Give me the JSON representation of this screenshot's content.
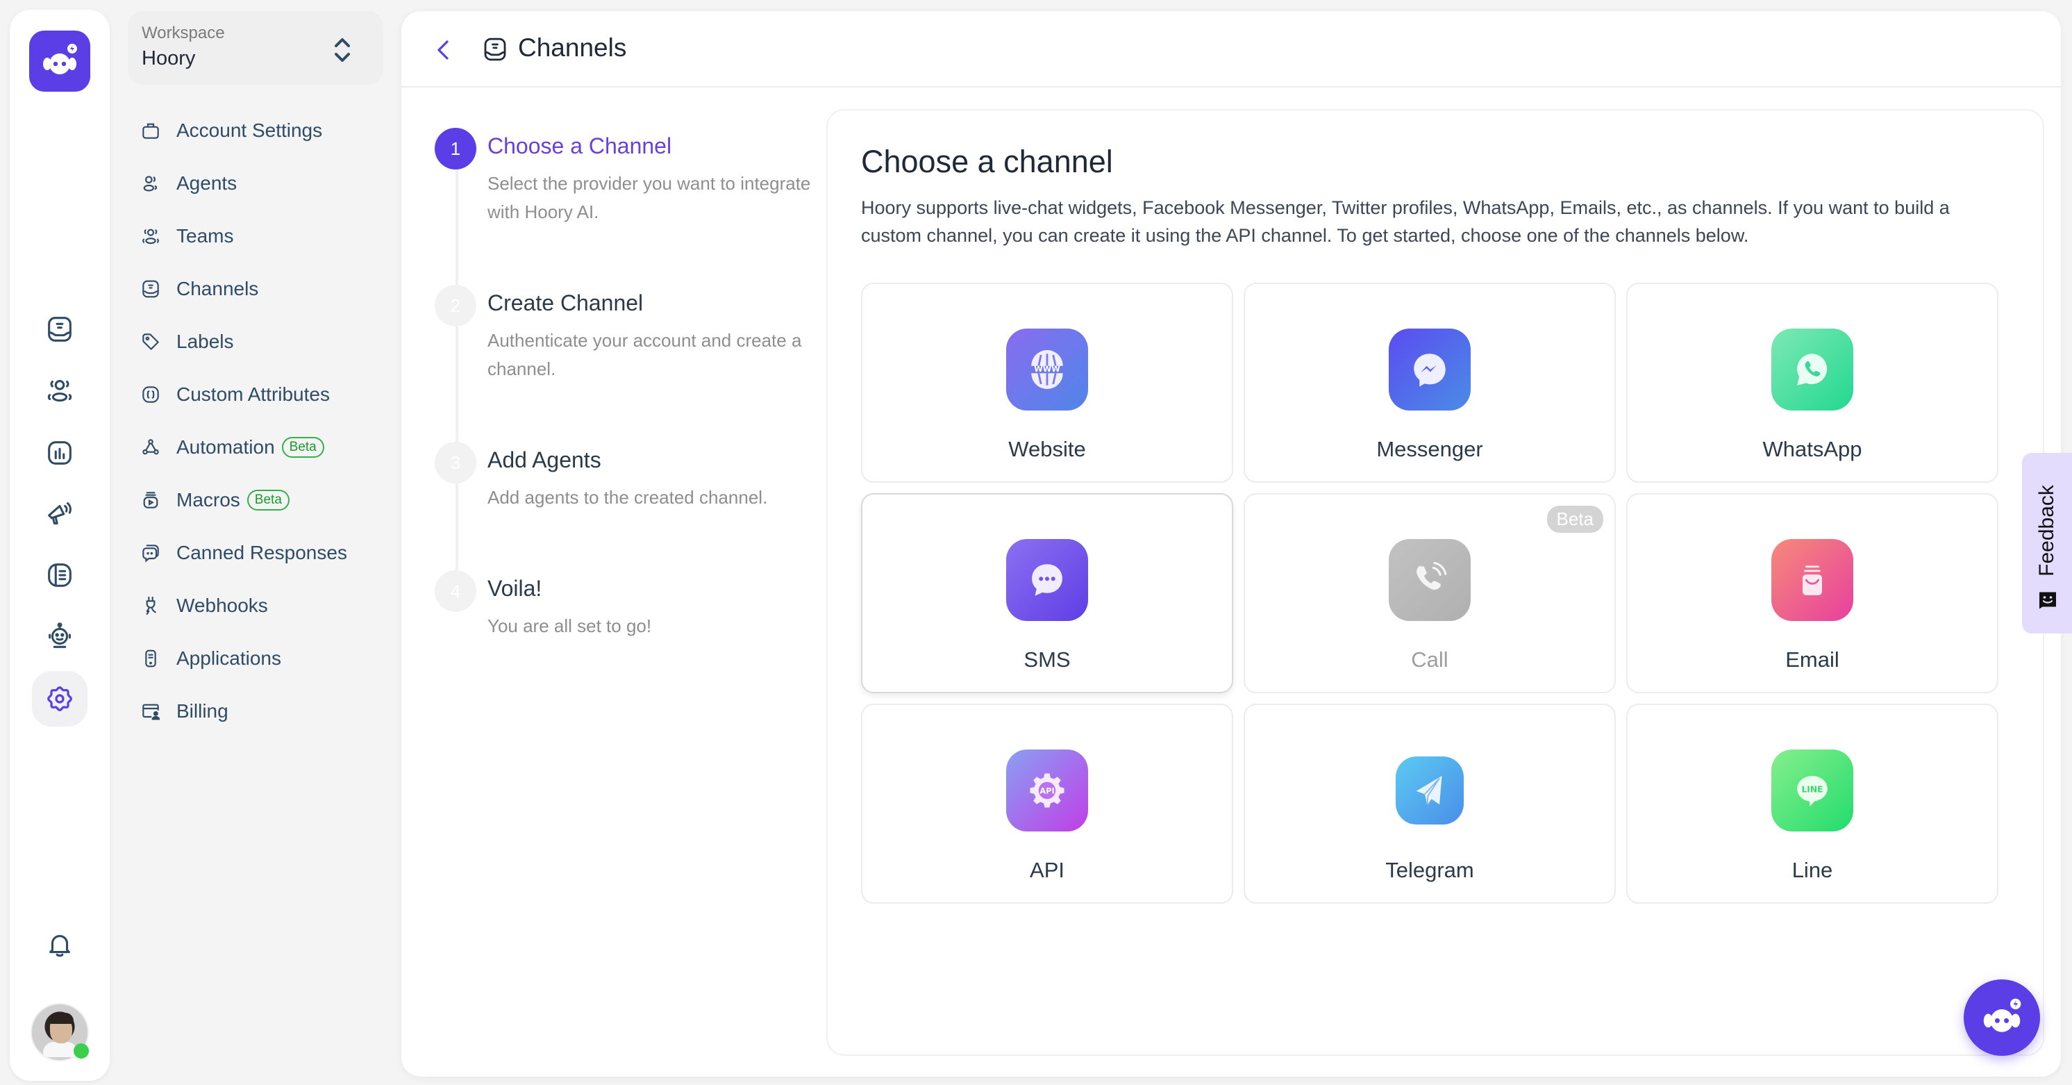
{
  "app": {
    "brand_color": "#5b3ee6",
    "logo": "hoory-bot-logo"
  },
  "rail": {
    "items": [
      {
        "name": "conversations",
        "icon": "inbox-icon"
      },
      {
        "name": "contacts",
        "icon": "contacts-icon"
      },
      {
        "name": "reports",
        "icon": "reports-icon"
      },
      {
        "name": "campaigns",
        "icon": "megaphone-icon"
      },
      {
        "name": "help-center",
        "icon": "book-icon"
      },
      {
        "name": "bot",
        "icon": "robot-icon"
      },
      {
        "name": "settings",
        "icon": "gear-icon",
        "active": true
      }
    ],
    "notifications_icon": "bell-icon",
    "user_status": "online"
  },
  "workspace": {
    "label": "Workspace",
    "name": "Hoory"
  },
  "settings_menu": [
    {
      "label": "Account Settings",
      "icon": "briefcase-icon"
    },
    {
      "label": "Agents",
      "icon": "agents-icon"
    },
    {
      "label": "Teams",
      "icon": "teams-icon"
    },
    {
      "label": "Channels",
      "icon": "channels-icon"
    },
    {
      "label": "Labels",
      "icon": "tag-icon"
    },
    {
      "label": "Custom Attributes",
      "icon": "braces-icon"
    },
    {
      "label": "Automation",
      "icon": "automation-icon",
      "badge": "Beta"
    },
    {
      "label": "Macros",
      "icon": "macros-icon",
      "badge": "Beta"
    },
    {
      "label": "Canned Responses",
      "icon": "canned-responses-icon"
    },
    {
      "label": "Webhooks",
      "icon": "plug-icon"
    },
    {
      "label": "Applications",
      "icon": "applications-icon"
    },
    {
      "label": "Billing",
      "icon": "billing-icon"
    }
  ],
  "header": {
    "title": "Channels",
    "back_label": "Back"
  },
  "steps": [
    {
      "num": "1",
      "title": "Choose a Channel",
      "desc": "Select the provider you want to integrate with Hoory AI.",
      "active": true
    },
    {
      "num": "2",
      "title": "Create Channel",
      "desc": "Authenticate your account and create a channel."
    },
    {
      "num": "3",
      "title": "Add Agents",
      "desc": "Add agents to the created channel."
    },
    {
      "num": "4",
      "title": "Voila!",
      "desc": "You are all set to go!"
    }
  ],
  "content": {
    "title": "Choose a channel",
    "description": "Hoory supports live-chat widgets, Facebook Messenger, Twitter profiles, WhatsApp, Emails, etc., as channels. If you want to build a custom channel, you can create it using the API channel. To get started, choose one of the channels below."
  },
  "channels": [
    {
      "label": "Website",
      "icon": "globe-www-icon",
      "gradient": [
        "#8a6cf0",
        "#4f86e8"
      ]
    },
    {
      "label": "Messenger",
      "icon": "messenger-icon",
      "gradient": [
        "#5b4cf0",
        "#4a8ce6"
      ]
    },
    {
      "label": "WhatsApp",
      "icon": "whatsapp-icon",
      "gradient": [
        "#7ee8b4",
        "#22d890"
      ]
    },
    {
      "label": "SMS",
      "icon": "sms-chat-icon",
      "gradient": [
        "#8a70f2",
        "#5f3fe4"
      ],
      "hovered": true
    },
    {
      "label": "Call",
      "icon": "phone-call-icon",
      "gradient": [
        "#c2c2c2",
        "#b0b0b0"
      ],
      "disabled": true,
      "badge": "Beta"
    },
    {
      "label": "Email",
      "icon": "email-icon",
      "gradient": [
        "#f58a7a",
        "#e8409e"
      ]
    },
    {
      "label": "API",
      "icon": "api-gear-icon",
      "gradient": [
        "#8aa0f4",
        "#c03ee6"
      ]
    },
    {
      "label": "Telegram",
      "icon": "telegram-icon",
      "gradient": [
        "#5ccaf2",
        "#4a8ee8"
      ]
    },
    {
      "label": "Line",
      "icon": "line-icon",
      "gradient": [
        "#86ef8c",
        "#22dc6c"
      ]
    }
  ],
  "feedback": {
    "label": "Feedback"
  }
}
